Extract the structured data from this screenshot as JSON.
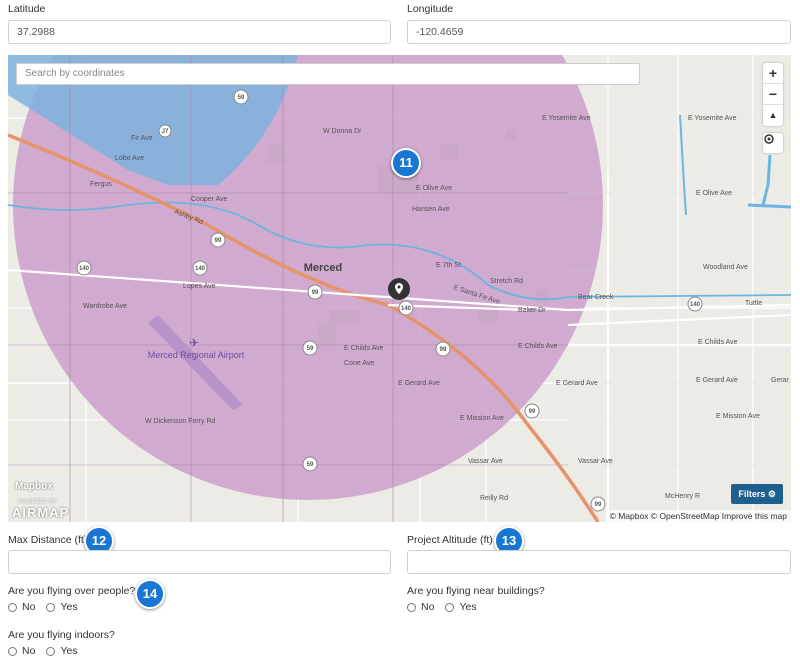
{
  "location": {
    "latitude_label": "Latitude",
    "latitude_value": "37.2988",
    "longitude_label": "Longitude",
    "longitude_value": "-120.4659"
  },
  "map": {
    "search_placeholder": "Search by coordinates",
    "zoom_in": "+",
    "zoom_out": "−",
    "compass": "▲",
    "filters_label": "Filters ⚙",
    "attribution": "© Mapbox © OpenStreetMap  Improve this map",
    "mapbox_logo": "Mapbox",
    "airmap_powered": "POWERED BY",
    "airmap_brand": "AIRMAP",
    "city_label": "Merced",
    "airport_label": "Merced Regional Airport",
    "colors": {
      "circle": "#c795c4",
      "restricted": "#6fa8d6",
      "highway": "#e8956b",
      "water": "#6fb7e0"
    },
    "street_labels": {
      "yosemite_w": "E Yosemite Ave",
      "yosemite_e": "E Yosemite Ave",
      "olive_w": "E Olive Ave",
      "olive_e": "E Olive Ave",
      "childs_w": "E Childs Ave",
      "childs_m": "E Childs Ave",
      "childs_e": "E Childs Ave",
      "gerard_w": "E Gerard Ave",
      "gerard_m": "E Gerard Ave",
      "gerard_e": "E Gerard Ave",
      "mission_w": "E Mission Ave",
      "mission_e": "E Mission Ave",
      "woodland": "Woodland Ave",
      "tuttle": "Tuttle",
      "bear_creek": "Bear Creek",
      "baker": "Baker Dr",
      "vassar_w": "Vassar Ave",
      "vassar_e": "Vassar Ave",
      "mchenry": "McHenry R",
      "reilly": "Reilly Rd",
      "cone": "Cone Ave",
      "dickenson": "W Dickenson Ferry Rd",
      "wardrobe": "Wardrobe Ave",
      "lopes": "Lopes Ave",
      "cooper": "Cooper Ave",
      "ashby": "Ashby Rd",
      "fergus": "Fergus",
      "fir": "Fir Ave",
      "lobo": "Lobo Ave",
      "donna": "W Donna Dr",
      "hansen": "Hansen Ave",
      "fifth": "E 7th St",
      "stretch": "Stretch Rd",
      "santa_fe": "E Santa Fe Ave",
      "childs_west": "E Childs Ave",
      "gerar": "Gerar"
    }
  },
  "markers": {
    "m11": "11",
    "m12": "12",
    "m13": "13",
    "m14": "14"
  },
  "form": {
    "max_distance_label": "Max Distance (ft)",
    "max_distance_value": "",
    "altitude_label": "Project Altitude (ft)",
    "altitude_value": "",
    "over_people_question": "Are you flying over people?",
    "near_buildings_question": "Are you flying near buildings?",
    "indoors_question": "Are you flying indoors?",
    "no_label": "No",
    "yes_label": "Yes"
  }
}
